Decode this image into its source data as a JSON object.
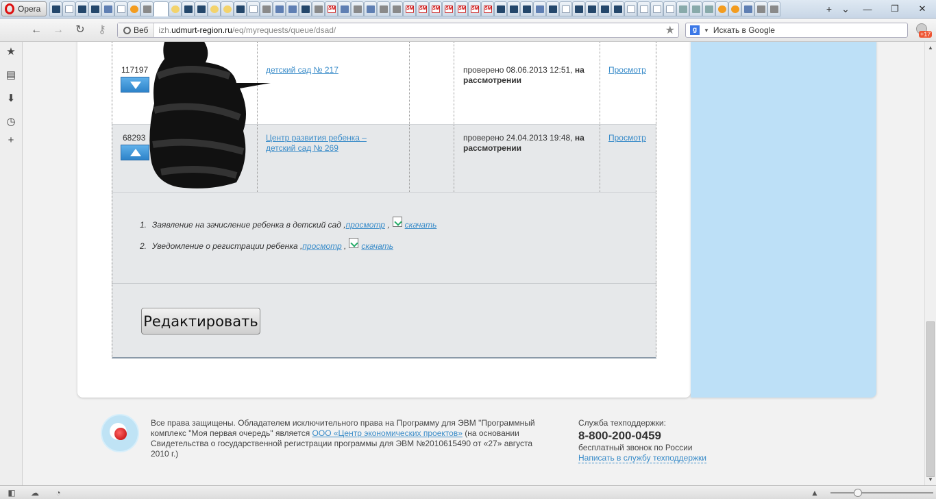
{
  "browser": {
    "menu_label": "Opera",
    "address": {
      "badge": "Веб",
      "host_prefix": "izh.",
      "host": "udmurt-region.ru",
      "path": "/eq/myrequests/queue/dsad/"
    },
    "search_placeholder": "Искать в Google",
    "search_engine_icon": "g-icon",
    "notification_count": "+17"
  },
  "requests": [
    {
      "id": "117197",
      "move": "down",
      "kindergarten": "детский сад № 217",
      "status_prefix": "проверено 08.06.2013 12:51,",
      "status_bold": "на рассмотрении",
      "view_label": "Просмотр"
    },
    {
      "id": "68293",
      "move": "up",
      "kindergarten": "Центр развития ребенка – детский сад № 269",
      "status_prefix": "проверено 24.04.2013 19:48,",
      "status_bold": "на рассмотрении",
      "view_label": "Просмотр"
    }
  ],
  "documents": [
    {
      "num": "1.",
      "title": "Заявление на зачисление ребенка в детский сад",
      "view_label": "просмотр",
      "download_label": "скачать"
    },
    {
      "num": "2.",
      "title": "Уведомление о регистрации ребенка",
      "view_label": "просмотр",
      "download_label": "скачать"
    }
  ],
  "edit_button_label": "Редактировать",
  "footer": {
    "copyright_1": "Все права защищены. Обладателем исключительного права на Программу для ЭВМ \"Программный комплекс \"Моя первая очередь\" является",
    "company_link": "ООО «Центр экономических проектов»",
    "copyright_2": "(на основании Свидетельства о государственной регистрации программы для ЭВМ №2010615490 от «27» августа 2010 г.)",
    "support_title": "Служба техподдержки:",
    "support_phone": "8-800-200-0459",
    "support_note": "бесплатный звонок по России",
    "support_link": "Написать в службу техподдержки"
  }
}
